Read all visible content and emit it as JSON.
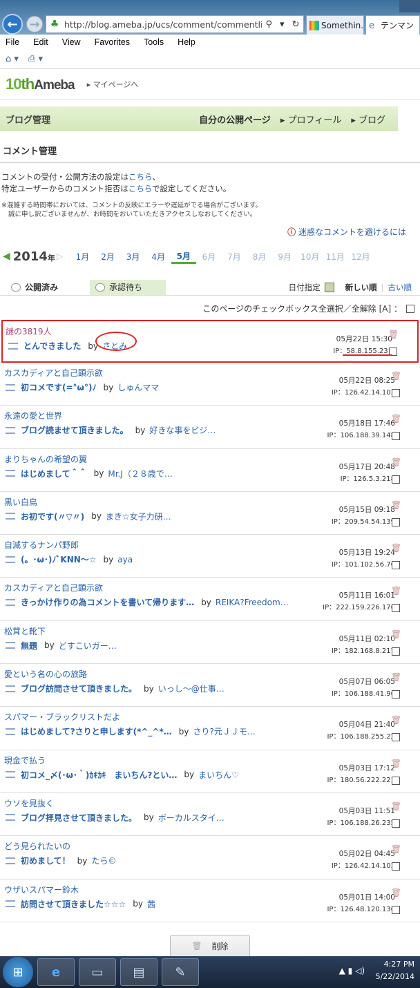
{
  "browser": {
    "url": "http://blog.ameba.jp/ucs/comment/commentlist.do",
    "tabs": [
      "Somethin...",
      "テンマン"
    ]
  },
  "menu": [
    "File",
    "Edit",
    "View",
    "Favorites",
    "Tools",
    "Help"
  ],
  "header": {
    "logo_num": "10",
    "logo_th": "th",
    "logo_brand": "Ameba",
    "mypage_link": "▸ マイページへ"
  },
  "blogbar": {
    "title": "ブログ管理",
    "public": "自分の公開ページ",
    "profile": "▸ プロフィール",
    "blog": "▸ ブログ"
  },
  "section_title": "コメント管理",
  "info": {
    "line1a": "コメントの受付・公開方法の設定は",
    "line1b": "こちら",
    "line1c": "、",
    "line2a": "特定ユーザーからのコメント拒否は",
    "line2b": "こちら",
    "line2c": "で設定してください。"
  },
  "notice": {
    "line1": "※混雑する時間帯においては、コメントの反映にエラーや遅延がでる場合がございます。",
    "line2": "誠に申し訳ございませんが、お時間をおいていただきアクセスしなおしてください。"
  },
  "avoid_link": "迷惑なコメントを避けるには",
  "year": "2014",
  "year_suffix": "年",
  "months": [
    "1月",
    "2月",
    "3月",
    "4月",
    "5月",
    "6月",
    "7月",
    "8月",
    "9月",
    "10月",
    "11月",
    "12月"
  ],
  "filter": {
    "published": "公開済み",
    "pending": "承認待ち",
    "date_select": "日付指定",
    "newest": "新しい順",
    "oldest": "古い順"
  },
  "select_all": "このページのチェックボックス全選択／全解除 [A] ：",
  "by_label": "by",
  "comments": [
    {
      "title": "謎の3819人",
      "subject": "とんできました",
      "author": "さとみ",
      "date": "05月22日 15:30",
      "ip": "IP：58.8.155.231"
    },
    {
      "title": "カスカディアと自己顕示欲",
      "subject": "初コメです(=°ω°)ﾉ",
      "author": "しゅんママ",
      "date": "05月22日 08:25",
      "ip": "IP：126.42.14.103"
    },
    {
      "title": "永遠の愛と世界",
      "subject": "ブログ読ませて頂きました。",
      "author": "好きな事をビジ…",
      "date": "05月18日 17:46",
      "ip": "IP：106.188.39.148"
    },
    {
      "title": "まりちゃんの希望の翼",
      "subject": "はじめまして＾＾",
      "author": "Mr.J（２８歳で…",
      "date": "05月17日 20:48",
      "ip": "IP：126.5.3.218"
    },
    {
      "title": "黒い白鳥",
      "subject": "お初です(〃▽〃)",
      "author": "まき☆女子力研…",
      "date": "05月15日 09:18",
      "ip": "IP：209.54.54.139"
    },
    {
      "title": "自滅するナンパ野郎",
      "subject": "(。･ω･)ﾉﾞKNN～☆",
      "author": "aya",
      "date": "05月13日 19:24",
      "ip": "IP：101.102.56.76"
    },
    {
      "title": "カスカディアと自己顕示欲",
      "subject": "きっかけ作りの為コメントを書いて帰ります…",
      "author": "REIKA?Freedom…",
      "date": "05月11日 16:01",
      "ip": "IP：222.159.226.176"
    },
    {
      "title": "松茸と靴下",
      "subject": "無題",
      "author": "どすこいガー…",
      "date": "05月11日 02:10",
      "ip": "IP：182.168.8.217"
    },
    {
      "title": "愛という名の心の旅路",
      "subject": "ブログ訪問させて頂きました。",
      "author": "いっし～@仕事…",
      "date": "05月07日 06:05",
      "ip": "IP：106.188.41.96"
    },
    {
      "title": "スパマー・ブラックリストだよ",
      "subject": "はじめまして?さりと申します(*^_^*…",
      "author": "さり?元ＪＪモ…",
      "date": "05月04日 21:40",
      "ip": "IP：106.188.255.22"
    },
    {
      "title": "現金で払う",
      "subject": "初コメ_〆(･ω･｀)ｶｷｶｷ　まいちん?とい…",
      "author": "まいちん♡",
      "date": "05月03日 17:12",
      "ip": "IP：180.56.222.221"
    },
    {
      "title": "ウソを見抜く",
      "subject": "ブログ拝見させて頂きました。",
      "author": "ボーカルスタイ…",
      "date": "05月03日 11:51",
      "ip": "IP：106.188.26.235"
    },
    {
      "title": "どう見られたいの",
      "subject": "初めまして！",
      "author": "たら©",
      "date": "05月02日 04:45",
      "ip": "IP：126.42.14.103"
    },
    {
      "title": "ウザいスパマー鈴木",
      "subject": "訪問させて頂きました☆☆☆",
      "author": "茜",
      "date": "05月01日 14:00",
      "ip": "IP：126.48.120.136"
    }
  ],
  "delete_button": "削除",
  "taskbar": {
    "time": "4:27 PM",
    "date": "5/22/2014"
  },
  "colors": {
    "accent_green": "#5a9e2d",
    "link_blue": "#2a62a6",
    "highlight_red": "#dd2222"
  }
}
